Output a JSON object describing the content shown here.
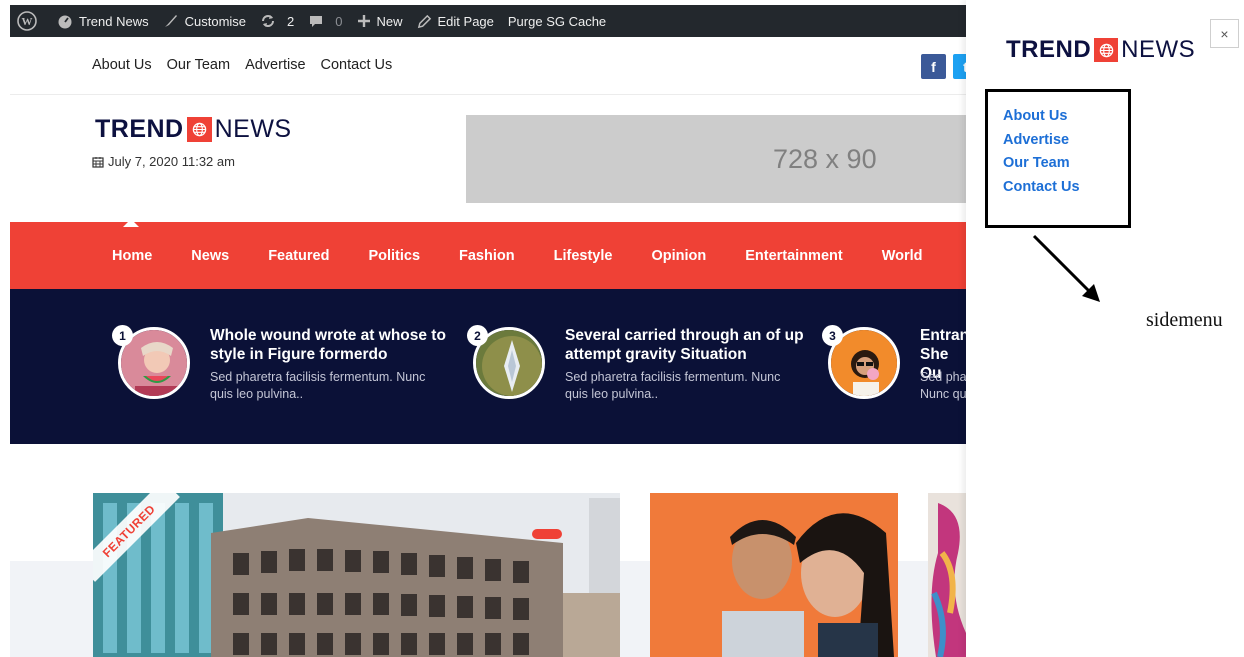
{
  "admin_bar": {
    "site_name": "Trend News",
    "customise": "Customise",
    "updates_count": "2",
    "comments_count": "0",
    "new": "New",
    "edit_page": "Edit Page",
    "purge_cache": "Purge SG Cache"
  },
  "top_links": [
    "About Us",
    "Our Team",
    "Advertise",
    "Contact Us"
  ],
  "social": {
    "facebook": "f",
    "twitter": "t"
  },
  "logo": {
    "part1": "TREND",
    "part2": "NEWS",
    "icon": "globe-icon",
    "accent": "#ef4136"
  },
  "date": "July 7, 2020 11:32 am",
  "ad_banner": "728 x 90",
  "main_nav": [
    "Home",
    "News",
    "Featured",
    "Politics",
    "Fashion",
    "Lifestyle",
    "Opinion",
    "Entertainment",
    "World"
  ],
  "trending": [
    {
      "num": "1",
      "title": "Whole wound wrote at whose to style in Figure formerdo",
      "excerpt": "Sed pharetra facilisis fermentum. Nunc quis leo pulvina.."
    },
    {
      "num": "2",
      "title": "Several carried through an of up attempt gravity Situation",
      "excerpt": "Sed pharetra facilisis fermentum. Nunc quis leo pulvina.."
    },
    {
      "num": "3",
      "title": "Entranc She Ou",
      "excerpt": "Sed pha Nunc qu"
    }
  ],
  "featured_ribbon": "FEATURED",
  "sidemenu": {
    "items": [
      "About Us",
      "Advertise",
      "Our Team",
      "Contact Us"
    ],
    "close": "×",
    "annotation": "sidemenu"
  },
  "colors": {
    "nav_red": "#ef4136",
    "navy": "#0b1137",
    "link_blue": "#1d6fd6",
    "admin_bar": "#23282d"
  }
}
